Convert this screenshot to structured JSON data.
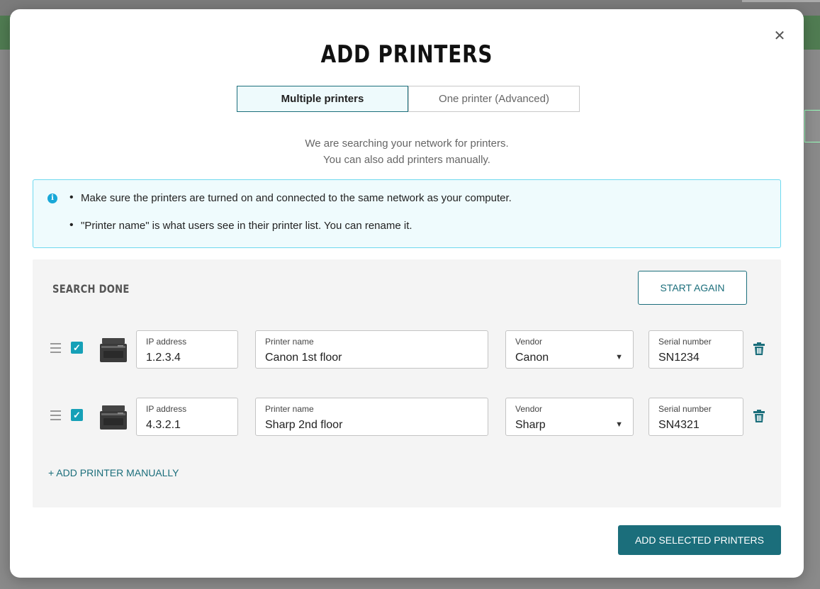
{
  "modal": {
    "title": "ADD PRINTERS",
    "close_glyph": "✕",
    "tabs": [
      {
        "label": "Multiple printers",
        "active": true
      },
      {
        "label": "One printer (Advanced)",
        "active": false
      }
    ],
    "subtitle_lines": [
      "We are searching your network for printers.",
      "You can also add printers manually."
    ],
    "info": {
      "icon": "info-icon",
      "bullets": [
        "Make sure the printers are turned on and connected to the same network as your computer.",
        "\"Printer name\" is what users see in their printer list. You can rename it."
      ]
    },
    "search": {
      "status": "SEARCH DONE",
      "start_again_label": "START AGAIN",
      "field_labels": {
        "ip": "IP address",
        "name": "Printer name",
        "vendor": "Vendor",
        "serial": "Serial number"
      },
      "printers": [
        {
          "checked": true,
          "ip": "1.2.3.4",
          "name": "Canon 1st floor",
          "vendor": "Canon",
          "serial": "SN1234"
        },
        {
          "checked": true,
          "ip": "4.3.2.1",
          "name": "Sharp 2nd floor",
          "vendor": "Sharp",
          "serial": "SN4321"
        }
      ],
      "add_manually_label": "+ ADD PRINTER MANUALLY"
    },
    "add_selected_label": "ADD SELECTED PRINTERS"
  },
  "colors": {
    "accent": "#1b6e7b",
    "checkbox": "#16a0b7",
    "info_border": "#6fd9ef",
    "info_bg": "#effbfd"
  }
}
